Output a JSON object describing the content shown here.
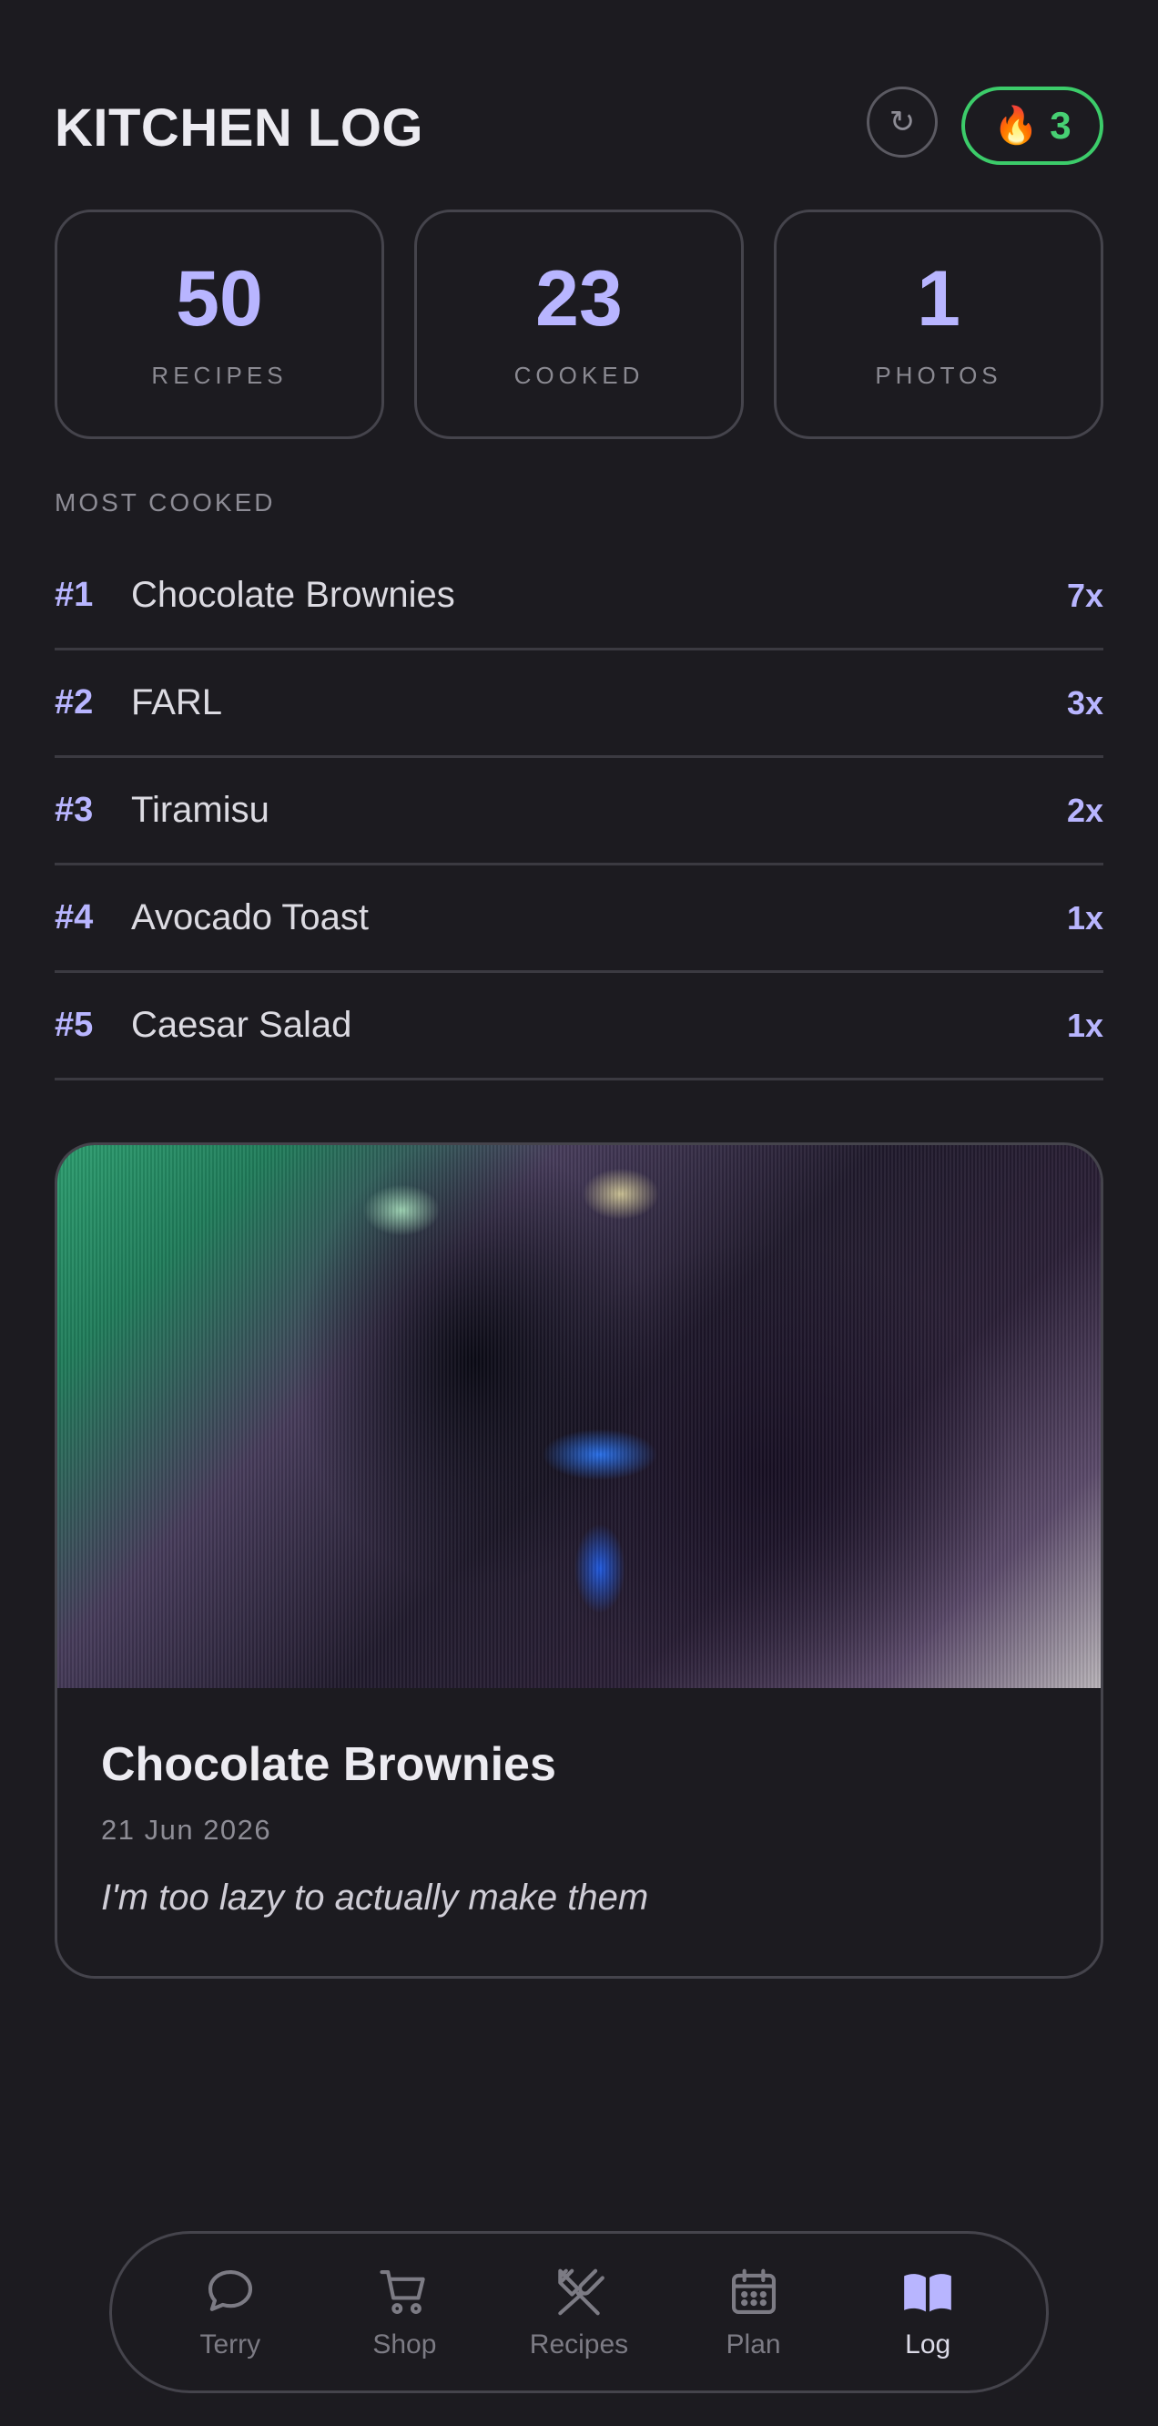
{
  "header": {
    "title": "KITCHEN LOG",
    "refresh_icon": "↻",
    "streak_icon": "🔥",
    "streak_count": "3",
    "streak_color": "#3ccc6a"
  },
  "stats": [
    {
      "value": "50",
      "label": "RECIPES"
    },
    {
      "value": "23",
      "label": "COOKED"
    },
    {
      "value": "1",
      "label": "PHOTOS"
    }
  ],
  "most_cooked": {
    "label": "MOST COOKED",
    "items": [
      {
        "rank": "#1",
        "name": "Chocolate Brownies",
        "count": "7x"
      },
      {
        "rank": "#2",
        "name": "FARL",
        "count": "3x"
      },
      {
        "rank": "#3",
        "name": "Tiramisu",
        "count": "2x"
      },
      {
        "rank": "#4",
        "name": "Avocado Toast",
        "count": "1x"
      },
      {
        "rank": "#5",
        "name": "Caesar Salad",
        "count": "1x"
      }
    ]
  },
  "photo_entry": {
    "title": "Chocolate Brownies",
    "date": "21 Jun 2026",
    "note": "I'm too lazy to actually make them"
  },
  "nav": {
    "items": [
      {
        "label": "Terry",
        "icon": "chat-bubble-icon"
      },
      {
        "label": "Shop",
        "icon": "cart-icon"
      },
      {
        "label": "Recipes",
        "icon": "utensils-icon"
      },
      {
        "label": "Plan",
        "icon": "calendar-icon"
      },
      {
        "label": "Log",
        "icon": "book-icon",
        "active": true
      }
    ]
  },
  "colors": {
    "background": "#1c1b20",
    "accent": "#b8b5ff",
    "border": "#45444c"
  }
}
